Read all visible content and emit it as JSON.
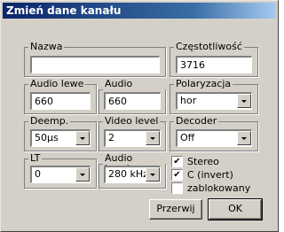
{
  "window": {
    "title": "Zmień dane kanału"
  },
  "fields": {
    "nazwa": {
      "label": "Nazwa",
      "value": ""
    },
    "czestotliwosc": {
      "label": "Częstotliwość",
      "value": "3716"
    },
    "audio_lewe": {
      "label": "Audio lewe",
      "value": "660"
    },
    "audio_prawe": {
      "label": "Audio prawe",
      "value": "660"
    },
    "polaryzacja": {
      "label": "Polaryzacja",
      "value": "hor"
    },
    "deemp": {
      "label": "Deemp.",
      "value": "50µs"
    },
    "video_level": {
      "label": "Video level",
      "value": "2"
    },
    "decoder": {
      "label": "Decoder",
      "value": "Off"
    },
    "lt": {
      "label": "LT",
      "value": "0"
    },
    "audio_bandw": {
      "label": "Audio bandw.",
      "value": "280 kHz"
    }
  },
  "checkboxes": {
    "stereo": {
      "label": "Stereo",
      "checked": true
    },
    "c_invert": {
      "label": "C (invert)",
      "checked": true
    },
    "zablokowany": {
      "label": "zablokowany",
      "checked": false
    }
  },
  "buttons": {
    "cancel": "Przerwij",
    "ok": "OK"
  }
}
